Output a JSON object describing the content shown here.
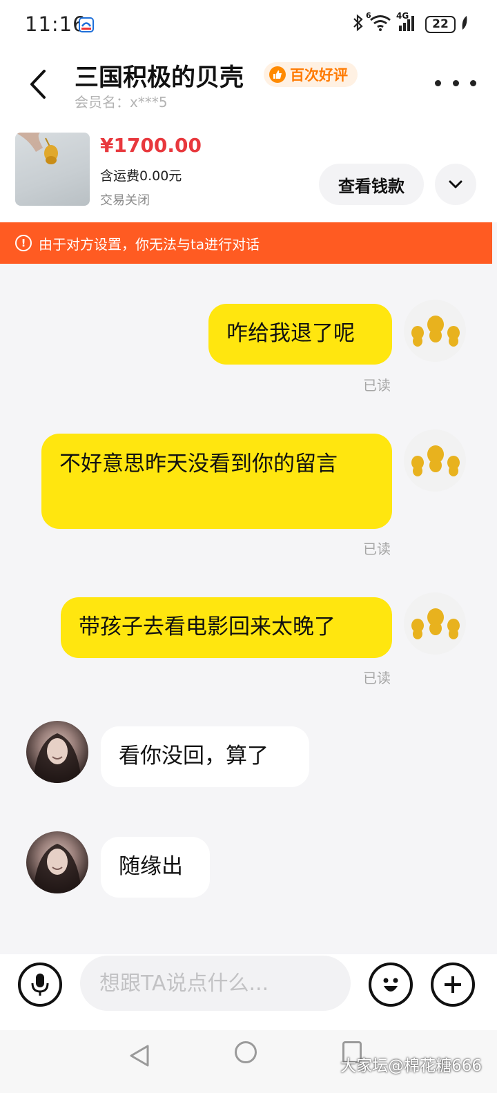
{
  "status_bar": {
    "time": "11:16",
    "battery": "22",
    "network": "4G",
    "wifi_sub": "6"
  },
  "header": {
    "title": "三国积极的贝壳",
    "badge": "百次好评",
    "member_name": "会员名：x***5"
  },
  "product": {
    "price": "¥1700.00",
    "shipping": "含运费0.00元",
    "status": "交易关闭",
    "view_payment_label": "查看钱款"
  },
  "warning": {
    "text": "由于对方设置，你无法与ta进行对话"
  },
  "messages": [
    {
      "from": "me",
      "text": "咋给我退了呢",
      "read": "已读"
    },
    {
      "from": "me",
      "text": "不好意思昨天没看到你的留言",
      "read": "已读"
    },
    {
      "from": "me",
      "text": "带孩子去看电影回来太晚了",
      "read": "已读"
    },
    {
      "from": "them",
      "text": "看你没回，算了"
    },
    {
      "from": "them",
      "text": "随缘出"
    }
  ],
  "input": {
    "placeholder": "想跟TA说点什么..."
  },
  "icons": {
    "back": "back-arrow-icon",
    "more": "more-dots-icon",
    "voice": "microphone-icon",
    "emoji": "emoji-icon",
    "plus": "plus-icon",
    "warning": "warning-icon"
  },
  "watermark": "大家坛@棉花糖666",
  "colors": {
    "accent_yellow": "#ffe60f",
    "warning_orange": "#ff5b22",
    "price_red": "#e8383d",
    "badge_orange": "#ff7a00"
  }
}
